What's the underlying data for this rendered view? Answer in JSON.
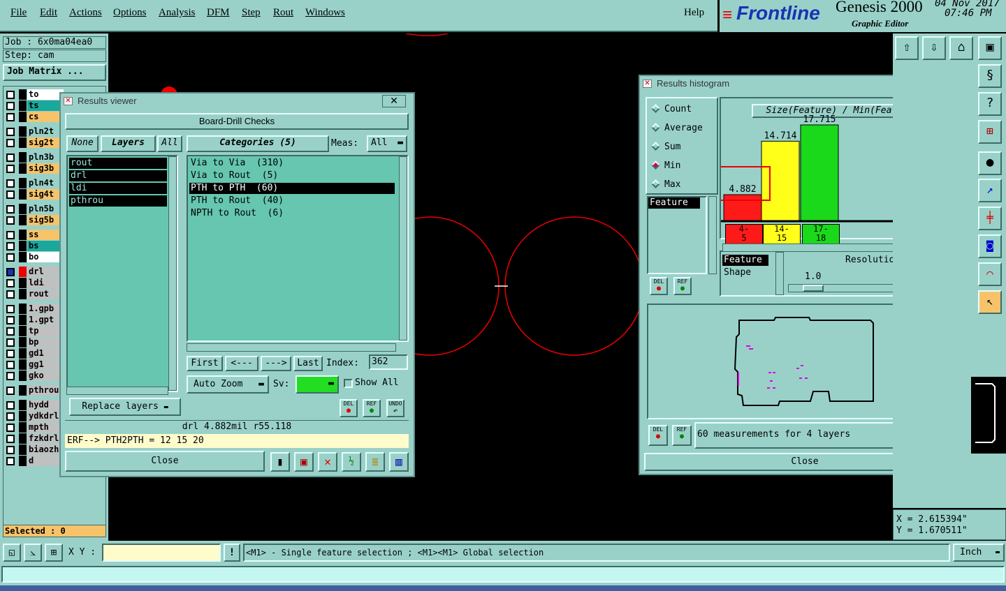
{
  "menubar": {
    "items": [
      "File",
      "Edit",
      "Actions",
      "Options",
      "Analysis",
      "DFM",
      "Step",
      "Rout",
      "Windows"
    ],
    "help": "Help"
  },
  "brand": {
    "logo": "Frontline",
    "product": "Genesis 2000",
    "subtitle": "Graphic Editor",
    "date": "04 Nov 2017",
    "time": "07:46 PM"
  },
  "left": {
    "job": "Job : 6x0ma04ea0",
    "step": "Step: cam",
    "job_matrix": "Job Matrix ...",
    "layers": [
      {
        "name": "to",
        "color": "#ffffff"
      },
      {
        "name": "ts",
        "color": "#1aa89c"
      },
      {
        "name": "cs",
        "color": "#f6c36b"
      },
      {
        "name": "pln2t",
        "color": "#99d1c9"
      },
      {
        "name": "sig2t",
        "color": "#f6c36b"
      },
      {
        "name": "pln3b",
        "color": "#99d1c9"
      },
      {
        "name": "sig3b",
        "color": "#f6c36b"
      },
      {
        "name": "pln4t",
        "color": "#99d1c9"
      },
      {
        "name": "sig4t",
        "color": "#f6c36b"
      },
      {
        "name": "pln5b",
        "color": "#99d1c9"
      },
      {
        "name": "sig5b",
        "color": "#f6c36b"
      },
      {
        "name": "ss",
        "color": "#f6c36b"
      },
      {
        "name": "bs",
        "color": "#1aa89c"
      },
      {
        "name": "bo",
        "color": "#ffffff"
      },
      {
        "name": "drl",
        "color": "#c0c0c0"
      },
      {
        "name": "ldi",
        "color": "#c0c0c0"
      },
      {
        "name": "rout",
        "color": "#c0c0c0"
      },
      {
        "name": "1.gpb",
        "color": "#c0c0c0"
      },
      {
        "name": "1.gpt",
        "color": "#c0c0c0"
      },
      {
        "name": "tp",
        "color": "#c0c0c0"
      },
      {
        "name": "bp",
        "color": "#c0c0c0"
      },
      {
        "name": "gd1",
        "color": "#c0c0c0"
      },
      {
        "name": "gg1",
        "color": "#c0c0c0"
      },
      {
        "name": "gko",
        "color": "#c0c0c0"
      },
      {
        "name": "pthrou",
        "color": "#c0c0c0"
      },
      {
        "name": "hydd",
        "color": "#c0c0c0"
      },
      {
        "name": "ydkdrl",
        "color": "#c0c0c0"
      },
      {
        "name": "mpth",
        "color": "#c0c0c0"
      },
      {
        "name": "fzkdrl",
        "color": "#c0c0c0"
      },
      {
        "name": "biaozh",
        "color": "#c0c0c0"
      },
      {
        "name": "d",
        "color": "#c0c0c0"
      }
    ],
    "selected": "Selected : 0"
  },
  "results_viewer": {
    "title": "Results viewer",
    "header": "Board-Drill Checks",
    "none_btn": "None",
    "layers_btn": "Layers",
    "all_btn": "All",
    "categories_btn": "Categories (5)",
    "meas_label": "Meas:",
    "meas_value": "All",
    "layers": [
      "rout",
      "drl",
      "ldi",
      "pthrou"
    ],
    "categories": [
      "Via to Via  (310)",
      "Via to Rout  (5)",
      "PTH to PTH  (60)",
      "PTH to Rout  (40)",
      "NPTH to Rout  (6)"
    ],
    "first": "First",
    "prev": "<---",
    "next": "--->",
    "last": "Last",
    "index_label": "Index:",
    "index_value": "362",
    "auto_zoom": "Auto Zoom",
    "sv_label": "Sv:",
    "show_all": "Show All",
    "replace_layers": "Replace layers",
    "del": "DEL",
    "ref": "REF",
    "undo": "UNDO",
    "status": "drl 4.882mil  r55.118",
    "erf": "ERF--> PTH2PTH = 12 15 20",
    "close": "Close"
  },
  "histogram": {
    "title": "Results histogram",
    "modes": [
      "Count",
      "Average",
      "Sum",
      "Min",
      "Max"
    ],
    "mode_selected": "Min",
    "feature_label": "Feature",
    "chart_title": "Size(Feature) / Min(Feature)",
    "bars": [
      {
        "value": "4.882",
        "range": "4-\n5",
        "color": "#ff1a1a"
      },
      {
        "value": "14.714",
        "range": "14-\n15",
        "color": "#ffff1a"
      },
      {
        "value": "17.715",
        "range": "17-\n18",
        "color": "#1ad91a"
      }
    ],
    "bar_values": [
      4.882,
      14.714,
      17.715
    ],
    "resolution_items": [
      "Feature",
      "Shape"
    ],
    "resolution_label": "Resolution",
    "resolution_value": "1.0",
    "measurements": "60 measurements for 4 layers",
    "del": "DEL",
    "ref": "REF",
    "close": "Close"
  },
  "coords": {
    "x": "X = 2.615394\"",
    "y": "Y = 1.670511\""
  },
  "bottom": {
    "xy_label": "X Y :",
    "hint": "<M1> - Single feature selection ; <M1><M1> Global selection",
    "units": "Inch"
  }
}
